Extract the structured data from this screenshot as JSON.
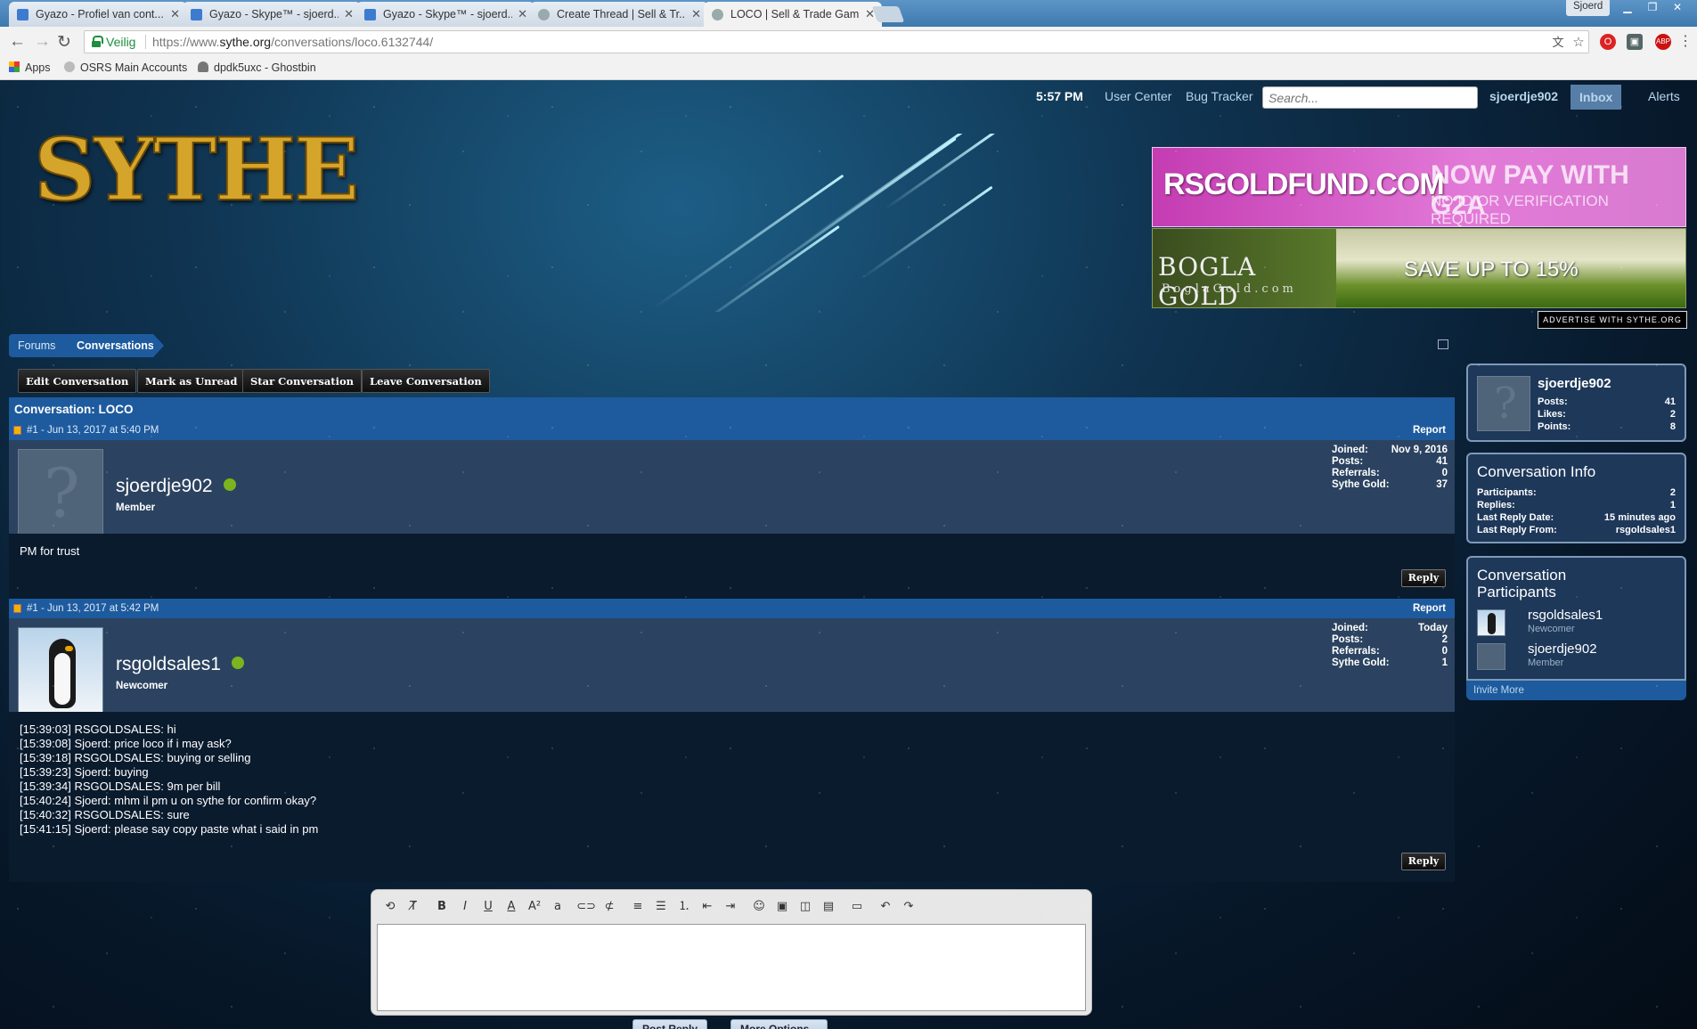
{
  "browser": {
    "tabs": [
      {
        "title": "Gyazo - Profiel van cont..."
      },
      {
        "title": "Gyazo - Skype™ - sjoerd..."
      },
      {
        "title": "Gyazo - Skype™ - sjoerd..."
      },
      {
        "title": "Create Thread | Sell & Tr..."
      },
      {
        "title": "LOCO | Sell & Trade Gam..."
      }
    ],
    "window_user": "Sjoerd",
    "secure_label": "Veilig",
    "url_prefix": "https://www.",
    "url_domain": "sythe.org",
    "url_path": "/conversations/loco.6132744/",
    "bookmarks": [
      {
        "label": "Apps"
      },
      {
        "label": "OSRS Main Accounts"
      },
      {
        "label": "dpdk5uxc - Ghostbin"
      }
    ]
  },
  "header": {
    "time": "5:57 PM",
    "user_center": "User Center",
    "bug_tracker": "Bug Tracker",
    "search_placeholder": "Search...",
    "username": "sjoerdje902",
    "inbox": "Inbox",
    "alerts": "Alerts",
    "logo_text": "SYTHE"
  },
  "ads": {
    "ad1_brand": "RSGOLDFUND.COM",
    "ad1_headline": "NOW PAY WITH G2A",
    "ad1_sub": "NO ID OR VERIFICATION REQUIRED",
    "ad2_brand": "BOGLA GOLD",
    "ad2_site": "BoglaGold.com",
    "ad2_headline": "SAVE UP TO 15%",
    "advertise": "ADVERTISE WITH SYTHE.ORG"
  },
  "breadcrumb": {
    "forums": "Forums",
    "conversations": "Conversations"
  },
  "actions": {
    "edit": "Edit Conversation",
    "mark_unread": "Mark as Unread",
    "star": "Star Conversation",
    "leave": "Leave Conversation"
  },
  "conversation": {
    "title": "Conversation: LOCO",
    "report_label": "Report",
    "reply_label": "Reply",
    "messages": [
      {
        "header": "#1 - Jun 13, 2017 at 5:40 PM",
        "username": "sjoerdje902",
        "user_title": "Member",
        "stats": [
          {
            "label": "Joined:",
            "value": "Nov 9, 2016"
          },
          {
            "label": "Posts:",
            "value": "41"
          },
          {
            "label": "Referrals:",
            "value": "0"
          },
          {
            "label": "Sythe Gold:",
            "value": "37"
          }
        ],
        "lines": [
          "PM for trust"
        ]
      },
      {
        "header": "#1 - Jun 13, 2017 at 5:42 PM",
        "username": "rsgoldsales1",
        "user_title": "Newcomer",
        "stats": [
          {
            "label": "Joined:",
            "value": "Today"
          },
          {
            "label": "Posts:",
            "value": "2"
          },
          {
            "label": "Referrals:",
            "value": "0"
          },
          {
            "label": "Sythe Gold:",
            "value": "1"
          }
        ],
        "lines": [
          "[15:39:03] RSGOLDSALES: hi",
          "[15:39:08] Sjoerd: price loco if i may ask?",
          "[15:39:18] RSGOLDSALES: buying or selling",
          "[15:39:23] Sjoerd: buying",
          "[15:39:34] RSGOLDSALES: 9m per bill",
          "[15:40:24] Sjoerd: mhm il pm u on sythe for confirm okay?",
          "[15:40:32] RSGOLDSALES: sure",
          "[15:41:15] Sjoerd: please say copy paste what i said in pm"
        ]
      }
    ]
  },
  "sidebar": {
    "user": {
      "name": "sjoerdje902",
      "stats": [
        {
          "label": "Posts:",
          "value": "41"
        },
        {
          "label": "Likes:",
          "value": "2"
        },
        {
          "label": "Points:",
          "value": "8"
        }
      ]
    },
    "info": {
      "title": "Conversation Info",
      "rows": [
        {
          "label": "Participants:",
          "value": "2"
        },
        {
          "label": "Replies:",
          "value": "1"
        },
        {
          "label": "Last Reply Date:",
          "value": "15 minutes ago"
        },
        {
          "label": "Last Reply From:",
          "value": "rsgoldsales1"
        }
      ]
    },
    "participants": {
      "title_line1": "Conversation",
      "title_line2": "Participants",
      "list": [
        {
          "name": "rsgoldsales1",
          "title": "Newcomer"
        },
        {
          "name": "sjoerdje902",
          "title": "Member"
        }
      ],
      "invite": "Invite More"
    }
  },
  "editor": {
    "post_reply": "Post Reply",
    "more_options": "More Options..."
  }
}
